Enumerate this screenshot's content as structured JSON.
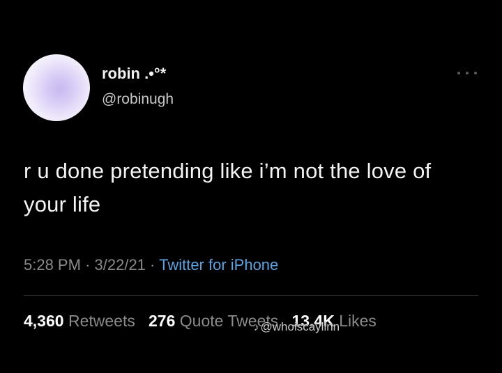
{
  "tweet": {
    "display_name": "robin .•°*",
    "handle": "@robinugh",
    "text": "r u done pretending like i’m not the love of your life",
    "time": "5:28 PM",
    "date": "3/22/21",
    "source": "Twitter for iPhone",
    "separator": "·",
    "more_icon": "more-horizontal-icon"
  },
  "stats": {
    "retweets_count": "4,360",
    "retweets_label": "Retweets",
    "quote_count": "276",
    "quote_label": "Quote Tweets",
    "likes_count": "13.4K",
    "likes_label": "Likes"
  },
  "watermark": {
    "icon": "tiktok-icon",
    "text": "@whoiscaylinn"
  },
  "colors": {
    "background": "#000000",
    "source_link": "#5ba3e0",
    "muted_text": "#8a8a8a"
  }
}
